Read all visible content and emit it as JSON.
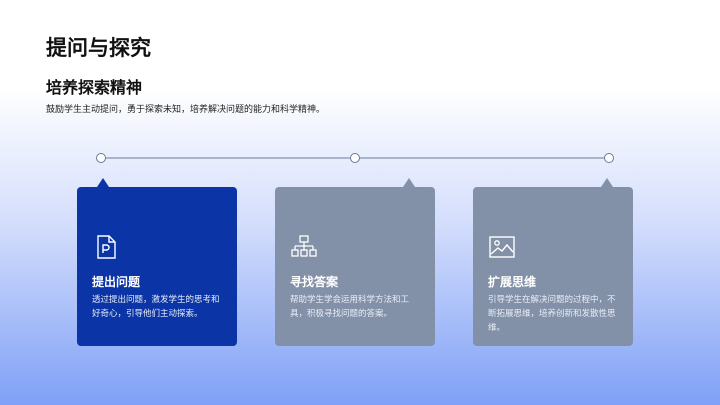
{
  "header": {
    "title": "提问与探究",
    "subtitle": "培养探索精神",
    "description": "鼓励学生主动提问，勇于探索未知，培养解决问题的能力和科学精神。"
  },
  "colors": {
    "accent": "#0b35a6",
    "muted_card": "#8391a8",
    "line": "#6b7a96"
  },
  "cards": [
    {
      "title": "提出问题",
      "text": "透过提出问题，激发学生的思考和好奇心，引导他们主动探索。",
      "icon": "document-p-icon",
      "active": true
    },
    {
      "title": "寻找答案",
      "text": "帮助学生学会运用科学方法和工具，积极寻找问题的答案。",
      "icon": "flowchart-icon",
      "active": false
    },
    {
      "title": "扩展思维",
      "text": "引导学生在解决问题的过程中，不断拓展思维，培养创新和发散性思维。",
      "icon": "image-icon",
      "active": false
    }
  ]
}
